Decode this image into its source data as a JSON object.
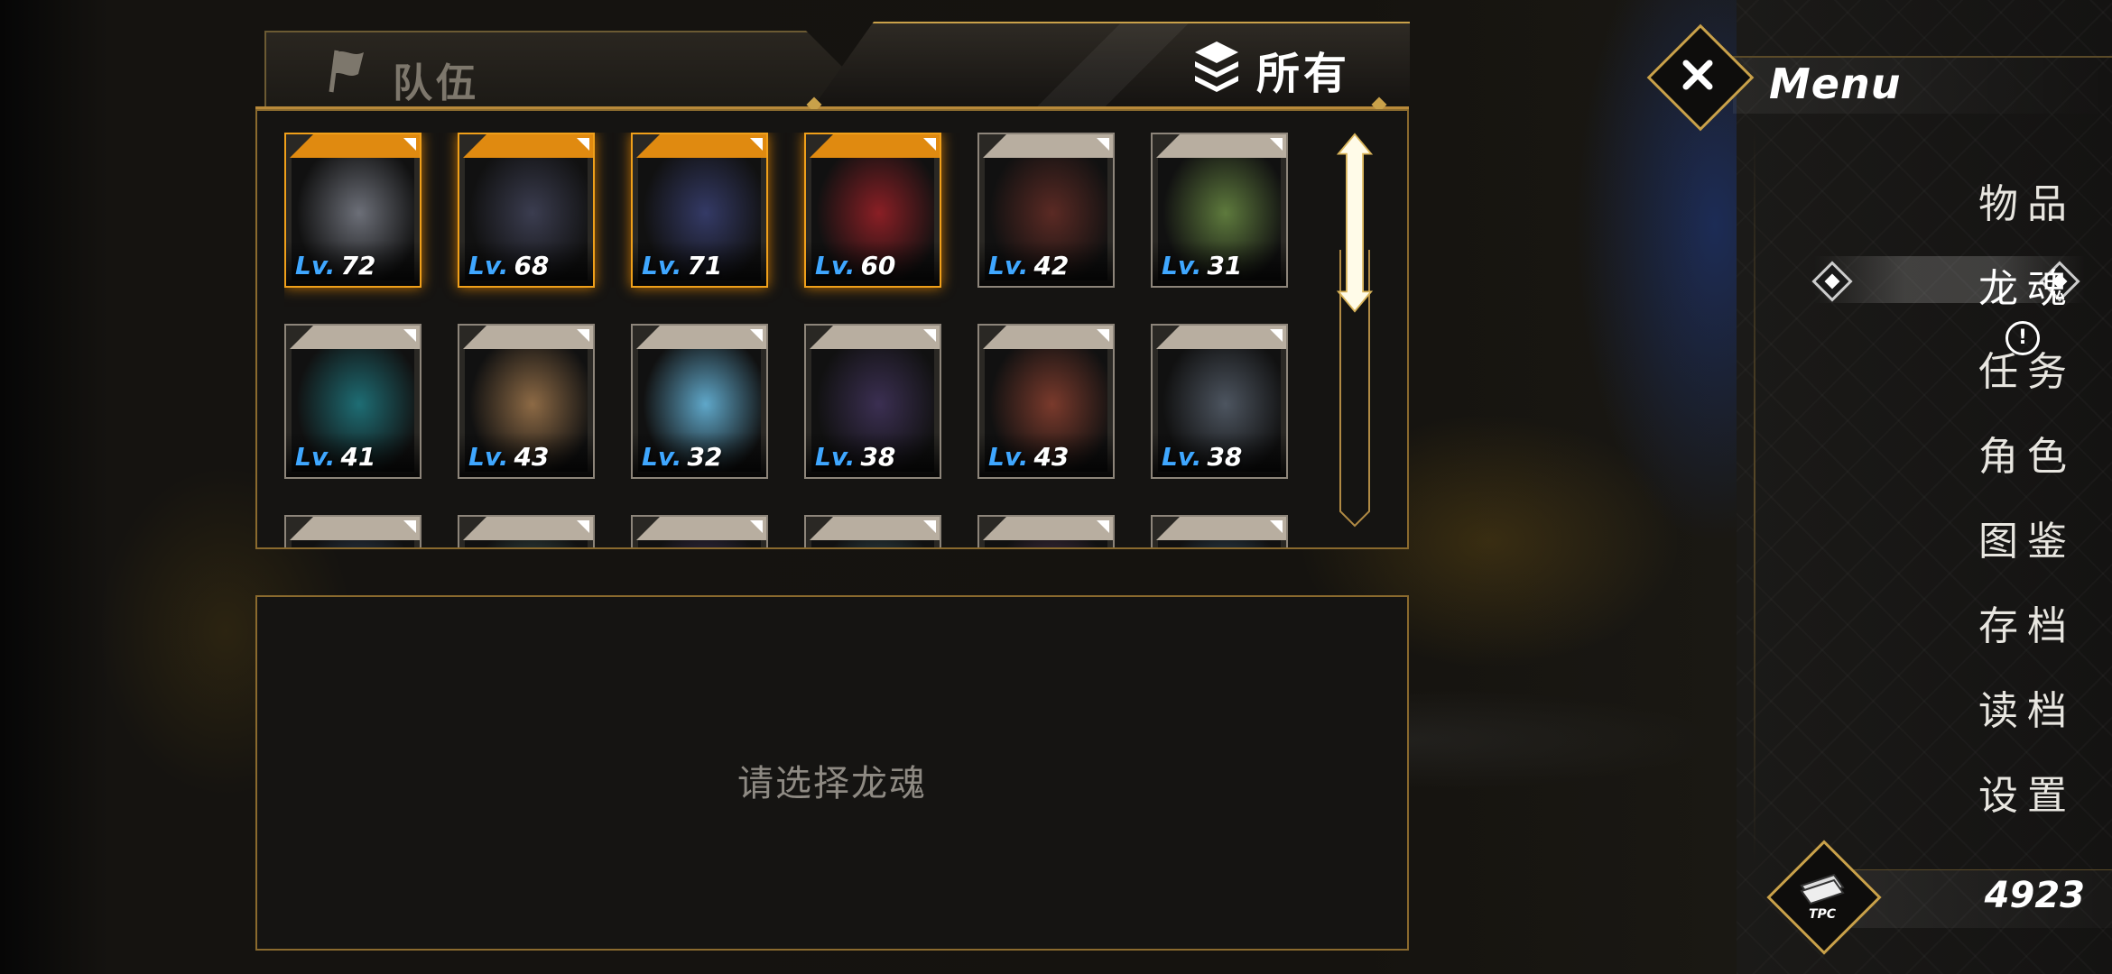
{
  "tabs": {
    "team": "队伍",
    "all": "所有"
  },
  "cards": [
    {
      "lv_prefix": "Lv.",
      "level": "72",
      "team": true,
      "tint": "#6c6f78"
    },
    {
      "lv_prefix": "Lv.",
      "level": "68",
      "team": true,
      "tint": "#3b3d50"
    },
    {
      "lv_prefix": "Lv.",
      "level": "71",
      "team": true,
      "tint": "#343a66"
    },
    {
      "lv_prefix": "Lv.",
      "level": "60",
      "team": true,
      "tint": "#8a1f25"
    },
    {
      "lv_prefix": "Lv.",
      "level": "42",
      "team": false,
      "tint": "#5b2a24"
    },
    {
      "lv_prefix": "Lv.",
      "level": "31",
      "team": false,
      "tint": "#5e7a3d"
    },
    {
      "lv_prefix": "Lv.",
      "level": "41",
      "team": false,
      "tint": "#1e6d74"
    },
    {
      "lv_prefix": "Lv.",
      "level": "43",
      "team": false,
      "tint": "#8d6a45"
    },
    {
      "lv_prefix": "Lv.",
      "level": "32",
      "team": false,
      "tint": "#5fa7c9"
    },
    {
      "lv_prefix": "Lv.",
      "level": "38",
      "team": false,
      "tint": "#3b2f52"
    },
    {
      "lv_prefix": "Lv.",
      "level": "43",
      "team": false,
      "tint": "#7a3a2c"
    },
    {
      "lv_prefix": "Lv.",
      "level": "38",
      "team": false,
      "tint": "#4d5560"
    },
    {
      "lv_prefix": "",
      "level": "",
      "team": false,
      "tint": "#3c4f68"
    },
    {
      "lv_prefix": "",
      "level": "",
      "team": false,
      "tint": "#45605c"
    },
    {
      "lv_prefix": "",
      "level": "",
      "team": false,
      "tint": "#4a3a62"
    },
    {
      "lv_prefix": "",
      "level": "",
      "team": false,
      "tint": "#3f5f66"
    },
    {
      "lv_prefix": "",
      "level": "",
      "team": false,
      "tint": "#5c3c5a"
    },
    {
      "lv_prefix": "",
      "level": "",
      "team": false,
      "tint": "#3e5a70"
    }
  ],
  "detail": {
    "hint": "请选择龙魂"
  },
  "menu": {
    "title": "Menu",
    "items": [
      "物品",
      "龙魂",
      "任务",
      "角色",
      "图鉴",
      "存档",
      "读档",
      "设置"
    ],
    "selected": "龙魂"
  },
  "currency": {
    "icon_label": "TPC",
    "value": "4923"
  },
  "colors": {
    "gold": "#c9a14a",
    "team_highlight": "#f0a01a",
    "level_blue": "#3fa7ff"
  }
}
